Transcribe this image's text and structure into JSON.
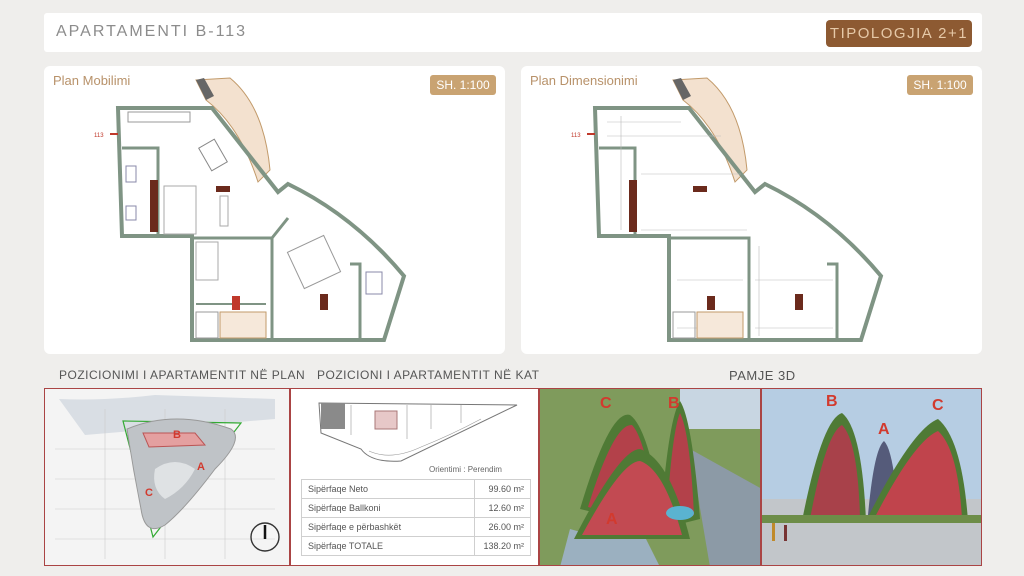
{
  "header": {
    "title": "APARTAMENTI B-113",
    "typology": "TIPOLOGJIA 2+1"
  },
  "panels": {
    "left": {
      "title": "Plan Mobilimi",
      "scale": "SH. 1:100",
      "entry_label": "113"
    },
    "right": {
      "title": "Plan Dimensionimi",
      "scale": "SH. 1:100",
      "entry_label": "113"
    }
  },
  "sections": {
    "position_plan": "POZICIONIMI I APARTAMENTIT NË PLAN",
    "position_floor": "POZICIONI I APARTAMENTIT NË KAT",
    "view3d": "PAMJE 3D"
  },
  "site_labels": {
    "a": "A",
    "b": "B",
    "c": "C"
  },
  "orientation": {
    "label": "Orientimi :",
    "value": "Perendim"
  },
  "areas": [
    {
      "label": "Sipërfaqe Neto",
      "value": "99.60 m²"
    },
    {
      "label": "Sipërfaqe Ballkoni",
      "value": "12.60 m²"
    },
    {
      "label": "Sipërfaqe e përbashkët",
      "value": "26.00 m²"
    },
    {
      "label": "Sipërfaqe TOTALE",
      "value": "138.20 m²"
    }
  ],
  "render_labels": {
    "left": {
      "a": "A",
      "b": "B",
      "c": "C"
    },
    "right": {
      "a": "A",
      "b": "B",
      "c": "C"
    }
  },
  "colors": {
    "accent_brown": "#8d5a32",
    "scale_gold": "#c9a372",
    "wall": "#7f9484",
    "frame_red": "#a44444",
    "label_red": "#d23a2e"
  }
}
